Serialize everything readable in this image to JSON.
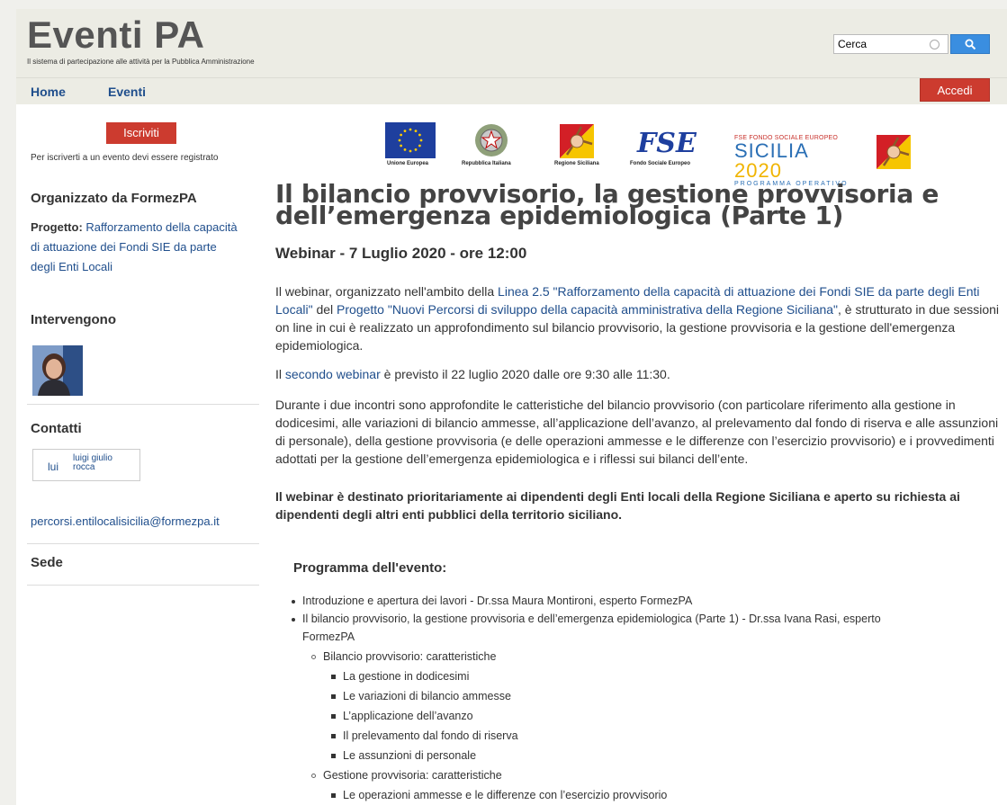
{
  "header": {
    "site_title": "Eventi PA",
    "tagline": "Il sistema di partecipazione alle attività per la Pubblica Amministrazione",
    "search_value": "Cerca",
    "search_icon": "search-icon"
  },
  "nav": {
    "items": [
      {
        "label": "Home"
      },
      {
        "label": "Eventi"
      }
    ],
    "login_label": "Accedi"
  },
  "sidebar": {
    "signup_label": "Iscriviti",
    "signup_note": "Per iscriverti a un evento devi essere registrato",
    "organizer_heading": "Organizzato da FormezPA",
    "project_label": "Progetto:",
    "project_link": "Rafforzamento della capacità di attuazione dei Fondi SIE da parte degli Enti Locali",
    "speakers_heading": "Intervengono",
    "contacts_heading": "Contatti",
    "contact_nick": "lui",
    "contact_name": "luigi giulio rocca",
    "contact_email": "percorsi.entilocalisicilia@formezpa.it",
    "venue_heading": "Sede"
  },
  "logos": {
    "eu": "Unione Europea",
    "italy": "Repubblica Italiana",
    "sicily": "Regione Siciliana",
    "fse": "Fondo Sociale Europeo",
    "fse_mark": "FSE",
    "po_line1": "FSE FONDO SOCIALE EUROPEO",
    "po_line2a": "SICILIA ",
    "po_line2b": "2020",
    "po_line3": "PROGRAMMA OPERATIVO"
  },
  "main": {
    "title": "Il bilancio provvisorio, la gestione provvisoria e dell’emergenza epidemiologica (Parte 1)",
    "subtitle": "Webinar - 7 Luglio 2020 - ore 12:00",
    "p1_a": "Il webinar, organizzato nell'ambito della ",
    "p1_link1": "Linea 2.5 \"Rafforzamento della capacità di attuazione dei Fondi SIE da parte degli Enti Locali\"",
    "p1_b": " del ",
    "p1_link2": "Progetto \"Nuovi Percorsi di sviluppo della capacità amministrativa della Regione Siciliana\"",
    "p1_c": ", è strutturato in due sessioni on line in cui è realizzato un approfondimento sul bilancio provvisorio, la gestione provvisoria e la gestione dell'emergenza epidemiologica.",
    "p2_a": "Il ",
    "p2_link": "secondo webinar",
    "p2_b": " è previsto il 22 luglio 2020 dalle ore 9:30 alle 11:30.",
    "p3": "Durante i due incontri sono approfondite le catteristiche del bilancio provvisorio (con particolare riferimento alla gestione in dodicesimi, alle variazioni di bilancio ammesse, all’applicazione dell’avanzo, al prelevamento dal fondo di riserva e alle assunzioni di personale), della gestione provvisoria (e delle  operazioni ammesse e le differenze con l’esercizio provvisorio) e i provvedimenti adottati per la gestione dell’emergenza epidemiologica e i riflessi sui bilanci dell’ente.",
    "p4": "Il webinar è destinato prioritariamente ai dipendenti degli Enti locali della Regione Siciliana e aperto su richiesta ai dipendenti degli altri enti pubblici della territorio siciliano.",
    "program_heading": "Programma dell'evento:",
    "program": [
      "Introduzione e apertura dei lavori - Dr.ssa Maura Montironi,  esperto FormezPA",
      "Il bilancio provvisorio, la gestione provvisoria e dell’emergenza epidemiologica (Parte 1) - Dr.ssa Ivana Rasi, esperto",
      "FormezPA",
      "Bilancio provvisorio: caratteristiche",
      "La gestione in dodicesimi",
      "Le variazioni di bilancio ammesse",
      "L’applicazione dell’avanzo",
      "Il prelevamento dal fondo di riserva",
      "Le assunzioni di personale",
      "Gestione provvisoria: caratteristiche",
      "Le operazioni ammesse e le differenze con l’esercizio provvisorio"
    ]
  }
}
